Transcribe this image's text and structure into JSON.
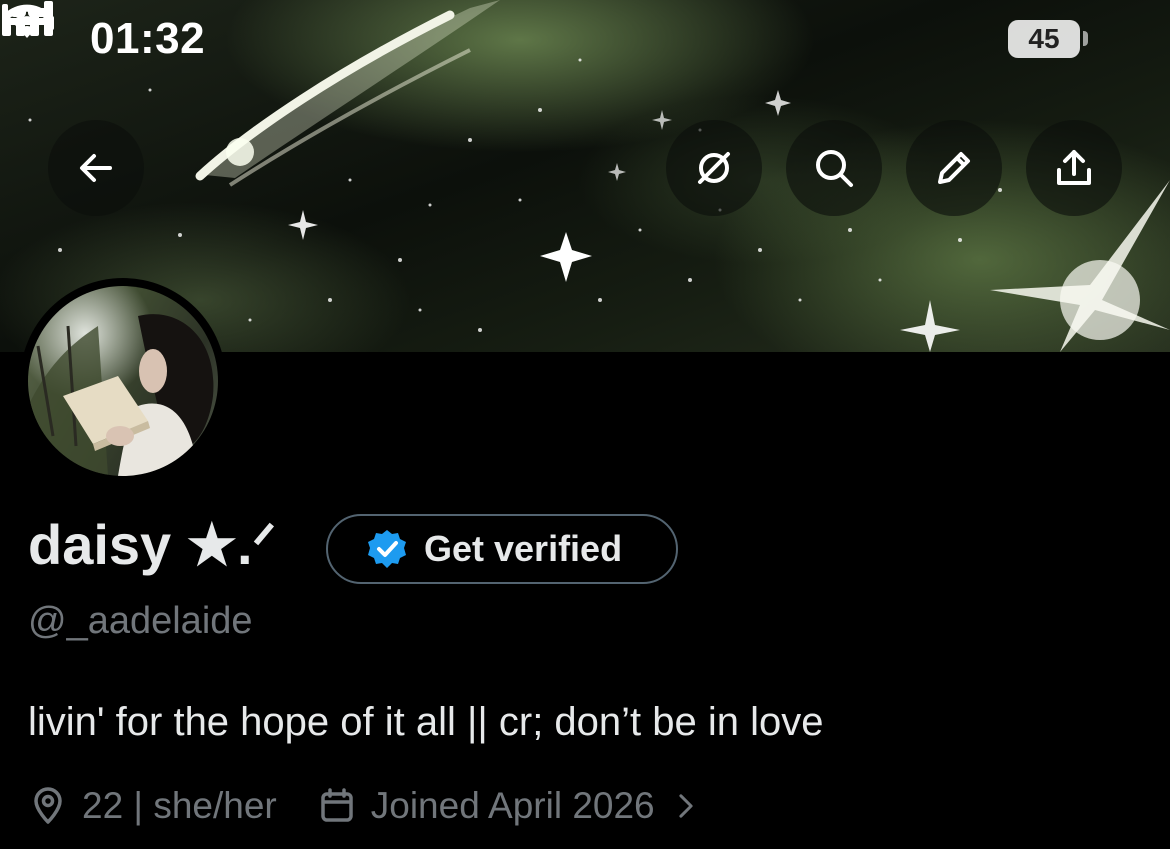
{
  "status_bar": {
    "time": "01:32",
    "focus_icon": "bed-icon",
    "signal_icon": "cellular-signal-icon",
    "wifi_icon": "wifi-icon",
    "battery_level": "45"
  },
  "header": {
    "buttons": [
      {
        "icon": "back-arrow-icon"
      },
      {
        "icon": "grok-icon"
      },
      {
        "icon": "search-icon"
      },
      {
        "icon": "edit-pencil-icon"
      },
      {
        "icon": "share-icon"
      }
    ]
  },
  "profile": {
    "display_name": "daisy ★.ᐟ",
    "verify_label": "Get verified",
    "verify_badge_color": "#1d9bf0",
    "handle": "@_aadelaide",
    "bio": "livin' for the hope of it all || cr; don’t be in love",
    "location": "22 | she/her",
    "joined": "Joined April 2026"
  },
  "colors": {
    "background": "#000000",
    "primary_text": "#e7e9ea",
    "secondary_text": "#71767b",
    "border": "#536471"
  }
}
